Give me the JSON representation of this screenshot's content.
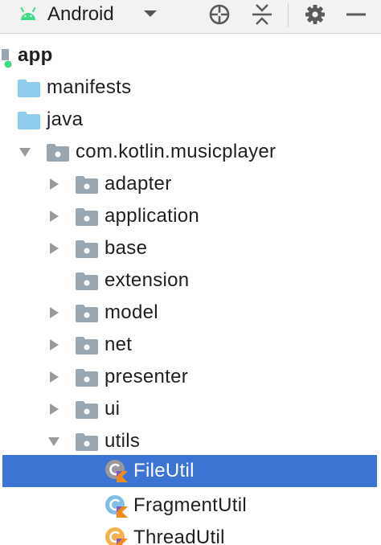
{
  "toolbar": {
    "view_label": "Android",
    "icons": [
      "android-icon",
      "chevron-down-icon",
      "crosshair-icon",
      "collapse-all-icon",
      "gear-icon",
      "minus-icon"
    ]
  },
  "tree": {
    "items": [
      {
        "label": "app",
        "kind": "module",
        "bold": true
      },
      {
        "label": "manifests",
        "kind": "folder"
      },
      {
        "label": "java",
        "kind": "folder"
      },
      {
        "label": "com.kotlin.musicplayer",
        "kind": "package",
        "expanded": true
      },
      {
        "label": "adapter",
        "kind": "package",
        "expanded": false
      },
      {
        "label": "application",
        "kind": "package",
        "expanded": false
      },
      {
        "label": "base",
        "kind": "package",
        "expanded": false
      },
      {
        "label": "extension",
        "kind": "package"
      },
      {
        "label": "model",
        "kind": "package",
        "expanded": false
      },
      {
        "label": "net",
        "kind": "package",
        "expanded": false
      },
      {
        "label": "presenter",
        "kind": "package",
        "expanded": false
      },
      {
        "label": "ui",
        "kind": "package",
        "expanded": false
      },
      {
        "label": "utils",
        "kind": "package",
        "expanded": true
      },
      {
        "label": "FileUtil",
        "kind": "kotlin-file",
        "selected": true
      },
      {
        "label": "FragmentUtil",
        "kind": "kotlin-file"
      },
      {
        "label": "ThreadUtil",
        "kind": "kotlin-file"
      }
    ]
  },
  "colors": {
    "toolbar_bg": "#f2f2f2",
    "selection": "#3b74d4",
    "folder_blue": "#8ecdf0",
    "package_gray": "#9aa7b0",
    "android_green": "#3ddc84",
    "kotlin_orange": "#f08a1a",
    "kotlin_blue": "#7fc0e8"
  }
}
